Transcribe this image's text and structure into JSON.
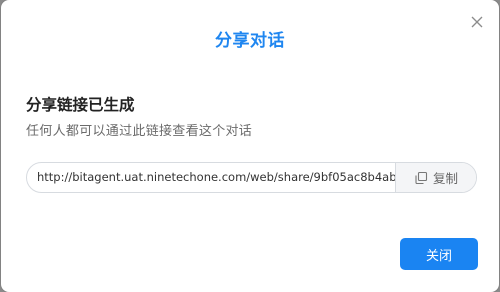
{
  "dialog": {
    "title": "分享对话",
    "close_icon": "close-icon",
    "section_title": "分享链接已生成",
    "section_subtitle": "任何人都可以通过此链接查看这个对话",
    "link_value": "http://bitagent.uat.ninetechone.com/web/share/9bf05ac8b4ab",
    "copy_label": "复制",
    "copy_icon": "copy-icon",
    "close_button_label": "关闭",
    "accent_color": "#1a84f2"
  }
}
